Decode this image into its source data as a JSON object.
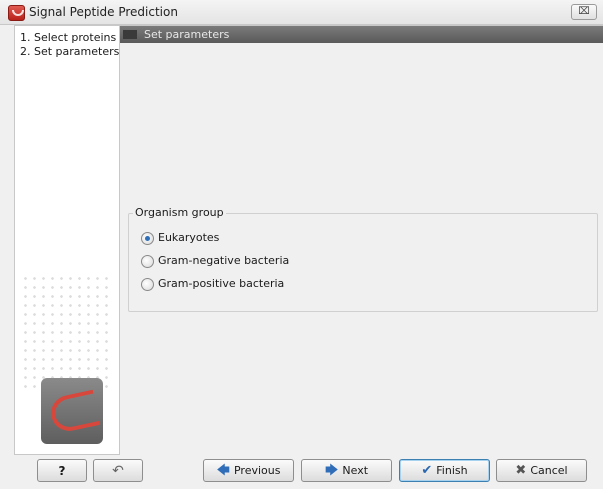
{
  "window": {
    "title": "Signal Peptide Prediction",
    "close_glyph": "⌧"
  },
  "steps": {
    "items": [
      {
        "label": "1. Select proteins"
      },
      {
        "label": "2. Set parameters"
      }
    ]
  },
  "content": {
    "header": "Set parameters",
    "organism_group": {
      "legend": "Organism group",
      "options": [
        {
          "label": "Eukaryotes",
          "checked": true
        },
        {
          "label": "Gram-negative bacteria",
          "checked": false
        },
        {
          "label": "Gram-positive bacteria",
          "checked": false
        }
      ]
    }
  },
  "buttons": {
    "help": "?",
    "reset_icon": "↶",
    "previous": "Previous",
    "next": "Next",
    "finish": "Finish",
    "cancel": "Cancel"
  },
  "icons": {
    "previous": "arrow-left-icon",
    "next": "arrow-right-icon",
    "finish": "checkmark-icon",
    "cancel": "cross-icon",
    "app": "app-logo-icon"
  },
  "colors": {
    "accent": "#2f6db8",
    "header_bar": "#6a6a6a",
    "logo_red": "#d8473c"
  }
}
